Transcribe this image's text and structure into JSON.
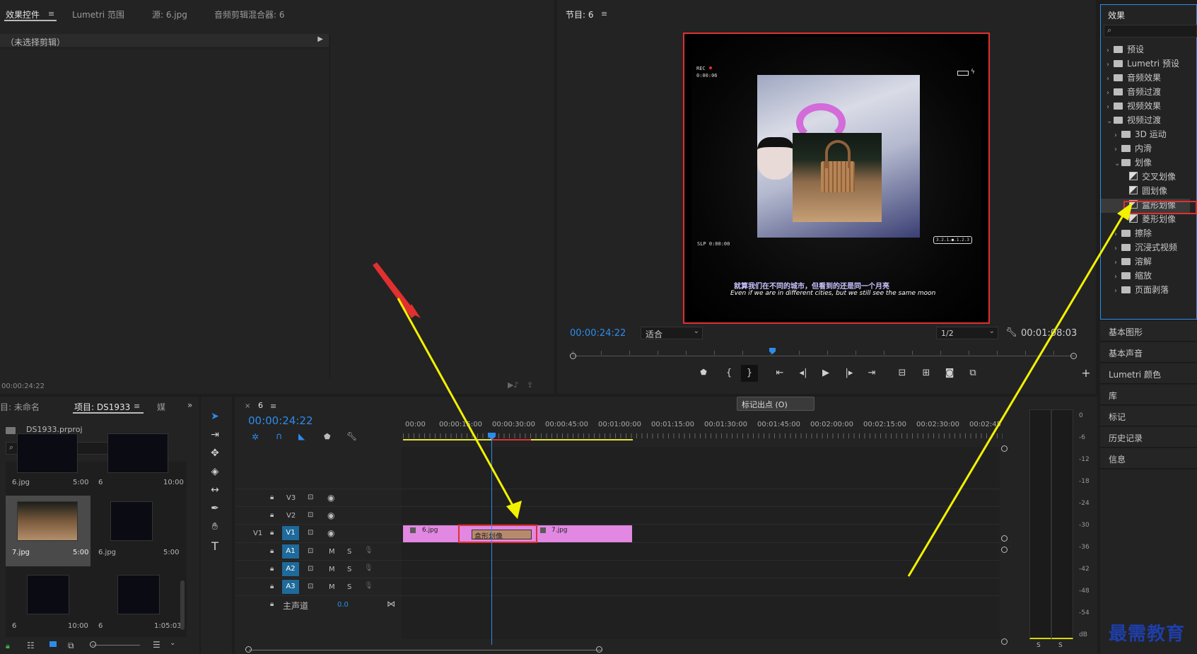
{
  "effect_controls": {
    "tabs": [
      "效果控件",
      "Lumetri 范围",
      "源: 6.jpg",
      "音频剪辑混合器: 6"
    ],
    "no_clip": "（未选择剪辑）",
    "timecode": "00:00:24:22"
  },
  "program": {
    "title": "节目: 6",
    "timecode": "00:00:24:22",
    "fit": "适合",
    "resolution": "1/2",
    "duration": "00:01:08:03",
    "rec_label": "REC",
    "rec_time": "0:00:06",
    "slp_label": "SLP 0:00:00",
    "counter": "3.2.1.●.1.2.3",
    "subtitle_cn": "就算我们在不同的城市，但看到的还是同一个月亮",
    "subtitle_en": "Even if we are in different cities, but we still see the same moon"
  },
  "effects": {
    "title": "效果",
    "items": [
      {
        "label": "预设",
        "level": 0,
        "type": "folder",
        "expanded": false
      },
      {
        "label": "Lumetri 预设",
        "level": 0,
        "type": "folder",
        "expanded": false
      },
      {
        "label": "音频效果",
        "level": 0,
        "type": "folder",
        "expanded": false
      },
      {
        "label": "音频过渡",
        "level": 0,
        "type": "folder",
        "expanded": false
      },
      {
        "label": "视频效果",
        "level": 0,
        "type": "folder",
        "expanded": false
      },
      {
        "label": "视频过渡",
        "level": 0,
        "type": "folder",
        "expanded": true
      },
      {
        "label": "3D 运动",
        "level": 1,
        "type": "folder",
        "expanded": false
      },
      {
        "label": "内滑",
        "level": 1,
        "type": "folder",
        "expanded": false
      },
      {
        "label": "划像",
        "level": 1,
        "type": "folder",
        "expanded": true
      },
      {
        "label": "交叉划像",
        "level": 2,
        "type": "preset"
      },
      {
        "label": "圆划像",
        "level": 2,
        "type": "preset"
      },
      {
        "label": "盒形划像",
        "level": 2,
        "type": "preset",
        "selected": true
      },
      {
        "label": "菱形划像",
        "level": 2,
        "type": "preset"
      },
      {
        "label": "擦除",
        "level": 1,
        "type": "folder",
        "expanded": false
      },
      {
        "label": "沉浸式视频",
        "level": 1,
        "type": "folder",
        "expanded": false
      },
      {
        "label": "溶解",
        "level": 1,
        "type": "folder",
        "expanded": false
      },
      {
        "label": "缩放",
        "level": 1,
        "type": "folder",
        "expanded": false
      },
      {
        "label": "页面剥落",
        "level": 1,
        "type": "folder",
        "expanded": false
      }
    ]
  },
  "side_panels": [
    "基本图形",
    "基本声音",
    "Lumetri 颜色",
    "库",
    "标记",
    "历史记录",
    "信息"
  ],
  "project": {
    "tabs": [
      "目: 未命名",
      "项目: DS1933",
      "媒"
    ],
    "file": "DS1933.prproj",
    "items": [
      {
        "name": "6.jpg",
        "duration": "5:00"
      },
      {
        "name": "6",
        "duration": "10:00"
      },
      {
        "name": "7.jpg",
        "duration": "5:00"
      },
      {
        "name": "6.jpg",
        "duration": "5:00"
      },
      {
        "name": "6",
        "duration": "10:00"
      },
      {
        "name": "6",
        "duration": "1:05:03"
      }
    ]
  },
  "timeline": {
    "tab": "6",
    "timecode": "00:00:24:22",
    "tooltip": "标记出点 (O)",
    "ruler": [
      "00:00",
      "00:00:15:00",
      "00:00:30:00",
      "00:00:45:00",
      "00:01:00:00",
      "00:01:15:00",
      "00:01:30:00",
      "00:01:45:00",
      "00:02:00:00",
      "00:02:15:00",
      "00:02:30:00",
      "00:02:45"
    ],
    "tracks": {
      "video": [
        "V3",
        "V2",
        "V1"
      ],
      "audio": [
        "A1",
        "A2",
        "A3"
      ],
      "source_label": "V1",
      "master_label": "主声道",
      "master_value": "0.0",
      "mute": "M",
      "solo": "S"
    },
    "clips": {
      "clip1": "6.jpg",
      "clip2": "7.jpg",
      "transition": "盒形划像"
    }
  },
  "meter": {
    "scale": [
      "0",
      "-6",
      "-12",
      "-18",
      "-24",
      "-30",
      "-36",
      "-42",
      "-48",
      "-54",
      "dB"
    ],
    "solo_left": "S",
    "solo_right": "S"
  },
  "watermark": "最需教育",
  "colors": {
    "accent": "#2d8ceb",
    "highlight": "#e03030",
    "clip": "#e287e2",
    "arrow_yellow": "#f2f200"
  }
}
